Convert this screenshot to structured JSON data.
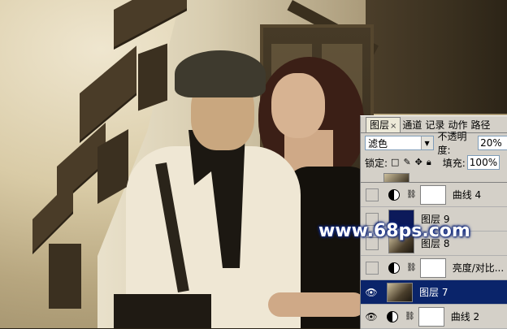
{
  "panel": {
    "tabs": [
      {
        "label": "图层",
        "active": true
      },
      {
        "label": "通道",
        "active": false
      },
      {
        "label": "记录",
        "active": false
      },
      {
        "label": "动作",
        "active": false
      },
      {
        "label": "路径",
        "active": false
      }
    ],
    "tab_close": "×",
    "blend_mode": "滤色",
    "opacity_label": "不透明度:",
    "opacity_value": "20%",
    "lock_label": "锁定:",
    "fill_label": "填充:",
    "fill_value": "100%",
    "layers": [
      {
        "name": "曲线 4",
        "visible": false,
        "type": "adjustment"
      },
      {
        "name": "图层 9",
        "visible": false,
        "type": "fill",
        "thumb_color": "#0c1a5a"
      },
      {
        "name": "图层 8",
        "visible": false,
        "type": "photo"
      },
      {
        "name": "亮度/对比...",
        "visible": false,
        "type": "adjustment"
      },
      {
        "name": "图层 7",
        "visible": true,
        "type": "photo",
        "selected": true
      },
      {
        "name": "曲线 2",
        "visible": true,
        "type": "adjustment"
      }
    ]
  },
  "watermark": "www.68ps.com",
  "colors": {
    "selected_row": "#0a246a",
    "panel_bg": "#d4d0c8",
    "watermark_glow": "#16318e"
  }
}
